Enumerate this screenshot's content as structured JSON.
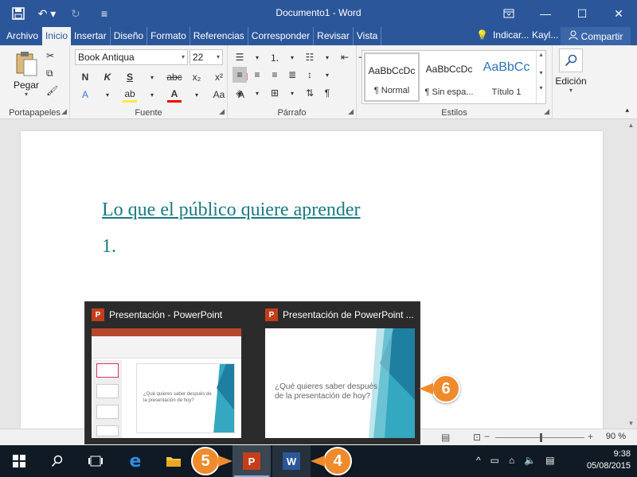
{
  "window": {
    "title": "Documento1 - Word",
    "qat": {
      "save_icon": "save-icon",
      "undo_icon": "undo-icon",
      "redo_icon": "redo-icon",
      "customize_icon": "customize-qat-icon"
    }
  },
  "tabs": [
    "Archivo",
    "Inicio",
    "Insertar",
    "Diseño",
    "Formato",
    "Referencias",
    "Corresponder",
    "Revisar",
    "Vista"
  ],
  "active_tab": "Inicio",
  "tell_me": "Indicar...",
  "user": "Kayl...",
  "share": "Compartir",
  "ribbon": {
    "clipboard": {
      "label": "Portapapeles",
      "paste": "Pegar"
    },
    "font": {
      "label": "Fuente",
      "name": "Book Antiqua",
      "size": "22"
    },
    "paragraph": {
      "label": "Párrafo"
    },
    "styles": {
      "label": "Estilos",
      "items": [
        {
          "preview": "AaBbCcDc",
          "name": "¶ Normal"
        },
        {
          "preview": "AaBbCcDc",
          "name": "¶ Sin espa..."
        },
        {
          "preview": "AaBbCc",
          "name": "Título 1"
        }
      ]
    },
    "editing": {
      "label": "Edición"
    }
  },
  "document": {
    "heading": "Lo que el público quiere aprender",
    "list_item": "1."
  },
  "status": {
    "zoom": "90 %"
  },
  "taskbar": {
    "time": "9:38",
    "date": "05/08/2015"
  },
  "popup": {
    "previews": [
      {
        "title": "Presentación - PowerPoint",
        "slide_text": "¿Qué quieres saber después de la presentación de hoy?"
      },
      {
        "title": "Presentación de PowerPoint ...",
        "slide_text": "¿Qué quieres saber después de la presentación de hoy?"
      }
    ]
  },
  "callouts": {
    "c4": "4",
    "c5": "5",
    "c6": "6"
  },
  "colors": {
    "word_blue": "#2b579a",
    "heading_teal": "#1a7a82",
    "callout_orange": "#ef8b2c",
    "taskbar": "#0f1a24"
  }
}
